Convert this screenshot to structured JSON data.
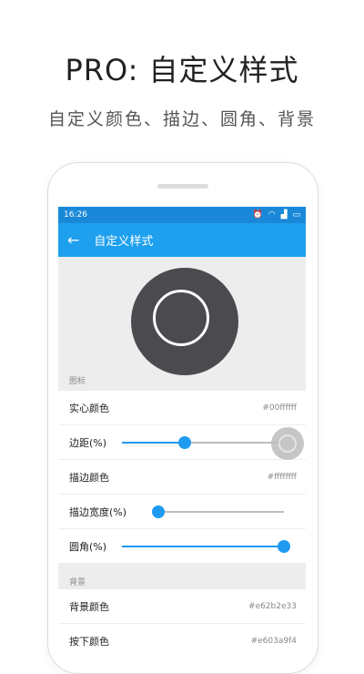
{
  "promo": {
    "headline": "PRO: 自定义样式",
    "subheadline": "自定义颜色、描边、圆角、背景"
  },
  "status_bar": {
    "time": "16:26"
  },
  "app_bar": {
    "title": "自定义样式"
  },
  "sections": {
    "icon_label": "图标",
    "background_label": "背景"
  },
  "settings": {
    "solid_color": {
      "label": "实心颜色",
      "value": "#00ffffff"
    },
    "padding": {
      "label": "边距(%)",
      "level": 0.39
    },
    "stroke_color": {
      "label": "描边颜色",
      "value": "#ffffffff"
    },
    "stroke_width": {
      "label": "描边宽度(%)",
      "level": 0.03
    },
    "corner": {
      "label": "圆角(%)",
      "level": 1.0
    },
    "bg_color": {
      "label": "背景颜色",
      "value": "#e62b2e33"
    },
    "pressed_color": {
      "label": "按下颜色",
      "value": "#e603a9f4"
    }
  },
  "colors": {
    "accent": "#1e9bf0",
    "app_bar": "#1ea0ee",
    "status_bar": "#1a88d8",
    "icon_disc": "#4a4a4f"
  }
}
